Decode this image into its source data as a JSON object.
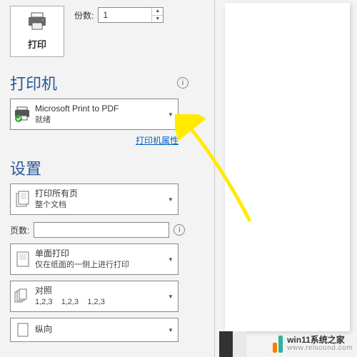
{
  "print_button": "打印",
  "copies": {
    "label": "份数:",
    "value": "1"
  },
  "section_printer": "打印机",
  "printer_dd": {
    "line1": "Microsoft Print to PDF",
    "line2": "就绪"
  },
  "printer_props_link": "打印机属性",
  "section_settings": "设置",
  "scope_dd": {
    "line1": "打印所有页",
    "line2": "整个文档"
  },
  "pages": {
    "label": "页数:"
  },
  "duplex_dd": {
    "line1": "单面打印",
    "line2": "仅在纸面的一侧上进行打印"
  },
  "collate_dd": {
    "line1": "对照",
    "line2": "1,2,3    1,2,3    1,2,3"
  },
  "orientation_dd": {
    "line1": "纵向",
    "line2": ""
  },
  "watermark": {
    "brand": "win11系统之家",
    "url": "www.relsound.com"
  },
  "colors": {
    "squares_left": "#323232",
    "squares_right": "#e8e8e8",
    "wm_orange": "#ff7a00",
    "wm_teal": "#2fb39a"
  }
}
